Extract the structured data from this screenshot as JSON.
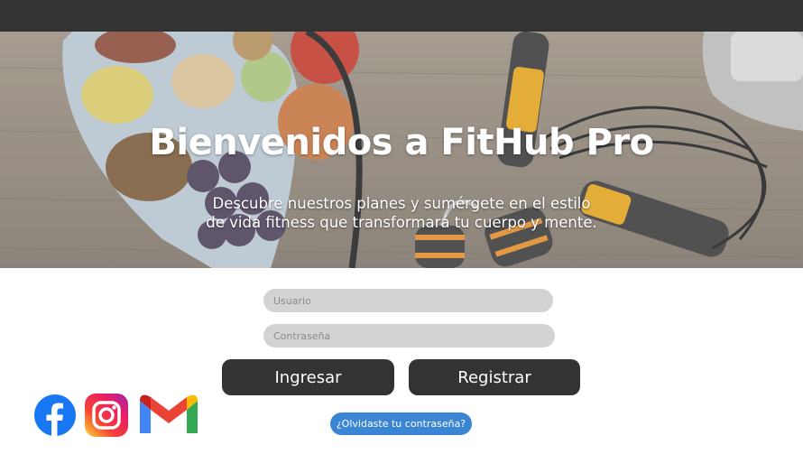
{
  "hero": {
    "title": "Bienvenidos a FitHub Pro",
    "subtitle_line1": "Descubre nuestros planes y sumérgete en el estilo",
    "subtitle_line2": "de vida fitness que transformará tu cuerpo y mente."
  },
  "form": {
    "username_placeholder": "Usuario",
    "password_placeholder": "Contraseña",
    "login_label": "Ingresar",
    "register_label": "Registrar",
    "forgot_label": "¿Olvidaste tu contraseña?"
  },
  "social": [
    {
      "icon": "facebook-icon"
    },
    {
      "icon": "instagram-icon"
    },
    {
      "icon": "gmail-icon"
    }
  ],
  "colors": {
    "topbar": "#333333",
    "button": "#333333",
    "input": "#d3d3d3",
    "link_button": "#3a86d4"
  }
}
